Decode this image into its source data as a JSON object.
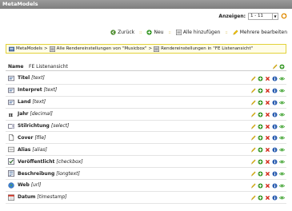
{
  "app": {
    "title": "MetaModels"
  },
  "display": {
    "label": "Anzeigen:",
    "selected": "1 - 11"
  },
  "actions": {
    "back": "Zurück",
    "new": "Neu",
    "add_all": "Alle hinzufügen",
    "edit_multiple": "Mehrere bearbeiten"
  },
  "breadcrumb": {
    "root": "MetaModels",
    "sep1": ">",
    "level1": "Alle Rendereinstellungen von \"Musicbox\"",
    "sep2": ">",
    "level2": "Rendereinstellungen in \"FE Listenansicht\""
  },
  "name_row": {
    "label": "Name",
    "value": "FE Listenansicht"
  },
  "colors": {
    "title_bar": "#8c8c8c",
    "breadcrumb_border": "#e2d23a",
    "edit": "#e2b400",
    "add": "#3a9a2a",
    "delete": "#d42a1a",
    "info": "#2a5db0",
    "visible": "#3aa02a"
  },
  "fields": [
    {
      "name": "Titel",
      "type": "[text]",
      "icon": "text-icon"
    },
    {
      "name": "Interpret",
      "type": "[text]",
      "icon": "text-icon"
    },
    {
      "name": "Land",
      "type": "[text]",
      "icon": "text-icon"
    },
    {
      "name": "Jahr",
      "type": "[decimal]",
      "icon": "pi-icon"
    },
    {
      "name": "Stilrichtung",
      "type": "[select]",
      "icon": "select-icon"
    },
    {
      "name": "Cover",
      "type": "[file]",
      "icon": "file-icon"
    },
    {
      "name": "Alias",
      "type": "[alias]",
      "icon": "alias-icon"
    },
    {
      "name": "Veröffentlicht",
      "type": "[checkbox]",
      "icon": "checkbox-icon"
    },
    {
      "name": "Beschreibung",
      "type": "[longtext]",
      "icon": "longtext-icon"
    },
    {
      "name": "Web",
      "type": "[url]",
      "icon": "globe-icon"
    },
    {
      "name": "Datum",
      "type": "[timestamp]",
      "icon": "calendar-icon"
    }
  ]
}
